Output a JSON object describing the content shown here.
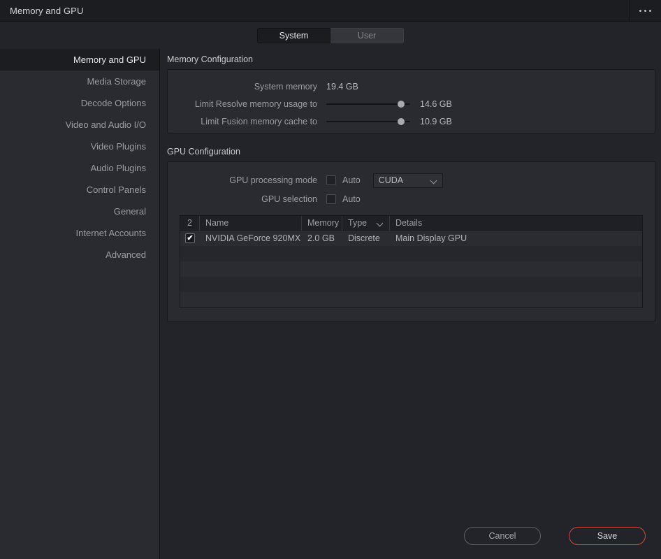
{
  "titlebar": {
    "title": "Memory and GPU",
    "menu_icon": "ellipsis-icon"
  },
  "tabs": [
    {
      "label": "System",
      "active": true
    },
    {
      "label": "User",
      "active": false
    }
  ],
  "sidebar": {
    "items": [
      {
        "label": "Memory and GPU",
        "selected": true
      },
      {
        "label": "Media Storage",
        "selected": false
      },
      {
        "label": "Decode Options",
        "selected": false
      },
      {
        "label": "Video and Audio I/O",
        "selected": false
      },
      {
        "label": "Video Plugins",
        "selected": false
      },
      {
        "label": "Audio Plugins",
        "selected": false
      },
      {
        "label": "Control Panels",
        "selected": false
      },
      {
        "label": "General",
        "selected": false
      },
      {
        "label": "Internet Accounts",
        "selected": false
      },
      {
        "label": "Advanced",
        "selected": false
      }
    ]
  },
  "memory_configuration": {
    "group_title": "Memory Configuration",
    "system_memory": {
      "label": "System memory",
      "value": "19.4 GB"
    },
    "limit_resolve": {
      "label": "Limit Resolve memory usage to",
      "value": "14.6 GB",
      "percent": 93
    },
    "limit_fusion": {
      "label": "Limit Fusion memory cache to",
      "value": "10.9 GB",
      "percent": 93
    }
  },
  "gpu_configuration": {
    "group_title": "GPU Configuration",
    "processing_mode": {
      "label": "GPU processing mode",
      "auto_label": "Auto",
      "auto_checked": false,
      "mode_value": "CUDA"
    },
    "selection": {
      "label": "GPU selection",
      "auto_label": "Auto",
      "auto_checked": false
    },
    "table": {
      "headers": {
        "count": "2",
        "name": "Name",
        "memory": "Memory",
        "type": "Type",
        "details": "Details"
      },
      "rows": [
        {
          "checked": true,
          "check_mark": "✔",
          "name": "NVIDIA GeForce 920MX",
          "memory": "2.0 GB",
          "type": "Discrete",
          "details": "Main Display GPU"
        }
      ],
      "empty_row_count": 4
    }
  },
  "footer": {
    "cancel_label": "Cancel",
    "save_label": "Save",
    "save_accent": "#d1483c"
  }
}
